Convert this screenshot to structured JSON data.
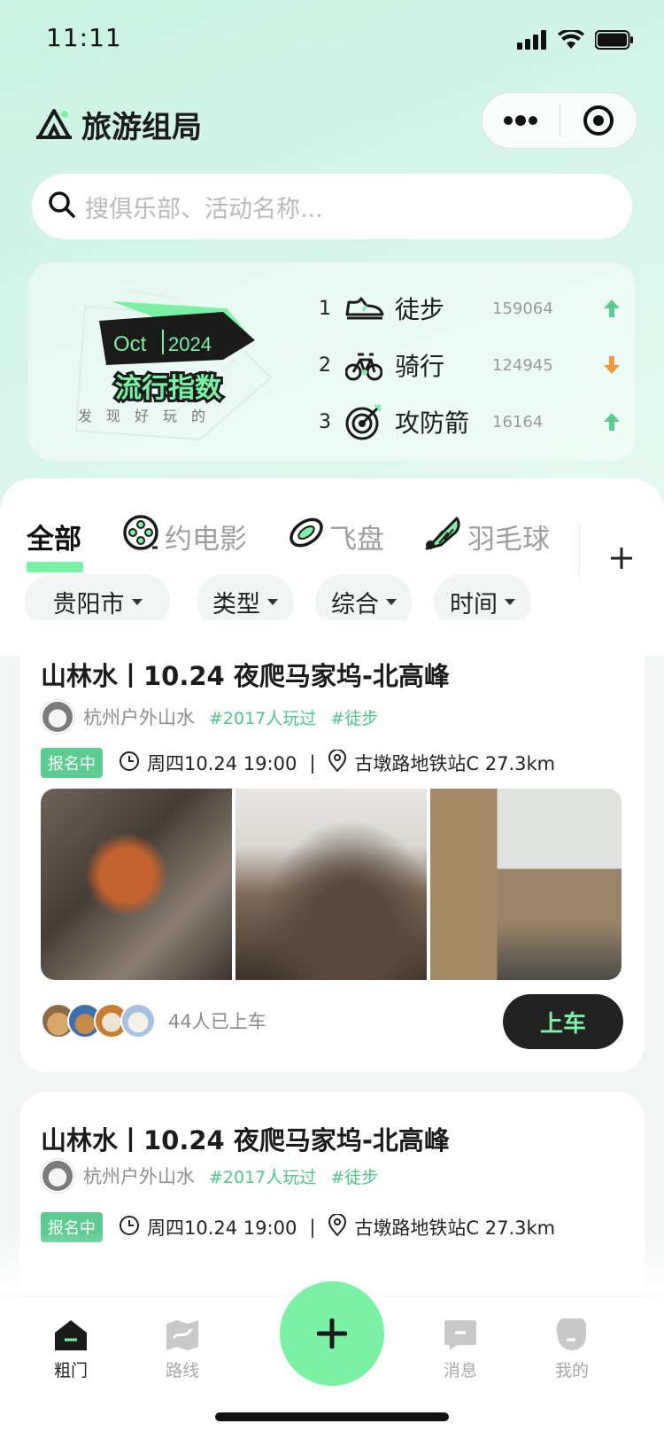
{
  "status": {
    "time": "11:11"
  },
  "app": {
    "title": "旅游组局"
  },
  "search": {
    "placeholder": "搜俱乐部、活动名称..."
  },
  "trend": {
    "month": "Oct",
    "year": "2024",
    "headline": "流行指数",
    "subtitle": "发现好玩的",
    "items": [
      {
        "rank": "1",
        "name": "徒步",
        "count": "159064",
        "icon": "sneaker-icon",
        "direction": "up"
      },
      {
        "rank": "2",
        "name": "骑行",
        "count": "124945",
        "icon": "bicycle-icon",
        "direction": "down"
      },
      {
        "rank": "3",
        "name": "攻防箭",
        "count": "16164",
        "icon": "target-icon",
        "direction": "up"
      }
    ]
  },
  "tabs": [
    {
      "label": "全部",
      "active": true
    },
    {
      "label": "约电影",
      "icon": "film-reel-icon"
    },
    {
      "label": "飞盘",
      "icon": "frisbee-icon"
    },
    {
      "label": "羽毛球",
      "icon": "shuttlecock-icon"
    }
  ],
  "filters": [
    {
      "label": "贵阳市"
    },
    {
      "label": "类型"
    },
    {
      "label": "综合"
    },
    {
      "label": "时间"
    }
  ],
  "cards": [
    {
      "title": "山林水丨10.24 夜爬马家坞-北高峰",
      "club": "杭州户外山水",
      "tags": [
        "#2017人玩过",
        "#徒步"
      ],
      "status": "报名中",
      "time": "周四10.24 19:00",
      "location": "古墩路地铁站C 27.3km",
      "riders_text": "44人已上车",
      "join_label": "上车"
    },
    {
      "title": "山林水丨10.24 夜爬马家坞-北高峰",
      "club": "杭州户外山水",
      "tags": [
        "#2017人玩过",
        "#徒步"
      ],
      "status": "报名中",
      "time": "周四10.24 19:00",
      "location": "古墩路地铁站C 27.3km"
    }
  ],
  "tabbar": [
    {
      "label": "粗门",
      "icon": "home-icon",
      "active": true
    },
    {
      "label": "路线",
      "icon": "map-icon"
    },
    {
      "label": "消息",
      "icon": "message-icon"
    },
    {
      "label": "我的",
      "icon": "profile-icon"
    }
  ],
  "colors": {
    "accent": "#7bf1a4",
    "tag": "#4cc88a",
    "up": "#5ccc91",
    "down": "#f39a3d"
  }
}
